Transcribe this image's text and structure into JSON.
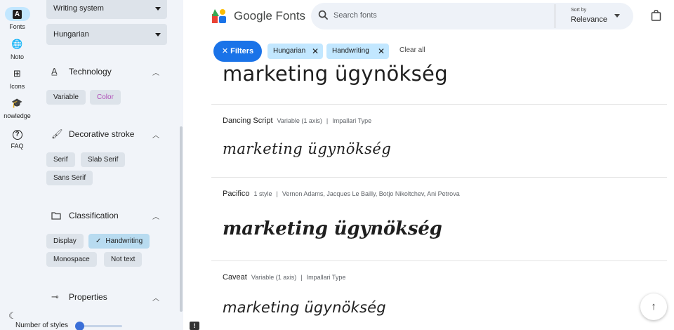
{
  "rail": {
    "items": [
      {
        "label": "Fonts",
        "icon": "A"
      },
      {
        "label": "Noto",
        "icon": "🌐"
      },
      {
        "label": "Icons",
        "icon": "⊞"
      },
      {
        "label": "nowledge",
        "icon": "🎓"
      },
      {
        "label": "FAQ",
        "icon": "?"
      }
    ],
    "theme_icon": "☾"
  },
  "panel": {
    "writing_system": "Writing system",
    "language": "Hungarian",
    "technology": {
      "title": "Technology",
      "chips": [
        "Variable",
        "Color"
      ]
    },
    "decorative_stroke": {
      "title": "Decorative stroke",
      "chips": [
        "Serif",
        "Slab Serif",
        "Sans Serif"
      ]
    },
    "classification": {
      "title": "Classification",
      "chips": [
        "Display",
        "Handwriting",
        "Monospace",
        "Not text"
      ],
      "selected": "Handwriting"
    },
    "properties": {
      "title": "Properties",
      "slider_label": "Number of styles",
      "slider_value": 0
    }
  },
  "header": {
    "brand": "Google Fonts",
    "search_placeholder": "Search fonts",
    "sort_label": "Sort by",
    "sort_value": "Relevance"
  },
  "filters": {
    "button_label": "Filters",
    "active": [
      "Hungarian",
      "Handwriting"
    ],
    "clear_all": "Clear all"
  },
  "results": [
    {
      "sample": "marketing ügynökség"
    },
    {
      "name": "Dancing Script",
      "styles": "Variable (1 axis)",
      "designer": "Impallari Type",
      "sample": "marketing ügynökség"
    },
    {
      "name": "Pacifico",
      "styles": "1 style",
      "designer": "Vernon Adams, Jacques Le Bailly, Botjo Nikoltchev, Ani Petrova",
      "sample": "marketing ügynökség"
    },
    {
      "name": "Caveat",
      "styles": "Variable (1 axis)",
      "designer": "Impallari Type",
      "sample": "marketing ügynökség"
    }
  ],
  "colors": {
    "accent": "#1a73e8",
    "chip": "#c2e7ff",
    "panel_bg": "#f1f4f9"
  }
}
